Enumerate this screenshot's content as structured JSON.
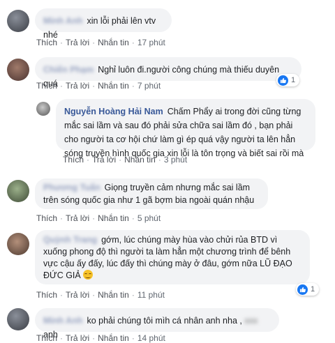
{
  "actions": {
    "like": "Thích",
    "reply": "Trả lời",
    "message": "Nhắn tin"
  },
  "comments": [
    {
      "author": "Minh Anh",
      "text": "xin lỗi phải lên vtv nhé",
      "time": "17 phút"
    },
    {
      "author": "Chiến Phạm",
      "text": "Nghỉ luôn đi.người công chúng mà thiếu duyên quá",
      "time": "7 phút",
      "likes": "1"
    },
    {
      "author": "Nguyễn Hoàng Hải Nam",
      "text": "Chấm Phẩy ai trong đời cũng từng mắc sai lầm và sau đó phải sửa chữa sai lầm đó , bạn phải cho người ta cơ hội chứ làm gì ép quá vậy người ta lên hẳn sóng truyền hình quốc gia xin lỗi là tôn trọng và biết sai rồi mà",
      "time": "3 phút"
    },
    {
      "author": "Phương Tuấn",
      "text": "Giọng truyền cảm nhưng mắc sai lầm trên sóng quốc gia như 1 gã bợm bia ngoài quán nhậu",
      "time": "5 phút"
    },
    {
      "author": "Quỳnh Trang",
      "text": "gớm, lúc chúng mày hùa vào chửi rủa BTD vì xuống phong độ thì người ta làm hẳn một chương trình để bênh vực cậu ấy đấy, lúc đấy thì chúng mày ở đâu, gớm nữa LŨ ĐẠO ĐỨC GIẢ",
      "time": "11 phút",
      "likes": "1"
    },
    {
      "author": "Minh Anh",
      "text_before": "ko phải chúng tôi mìh cá nhân anh nha ,",
      "censored": "xxx",
      "text_after": "anh",
      "time": "14 phút"
    }
  ],
  "colors": {
    "bubble": "#f2f3f5",
    "link": "#385898",
    "like": "#1877f2"
  }
}
